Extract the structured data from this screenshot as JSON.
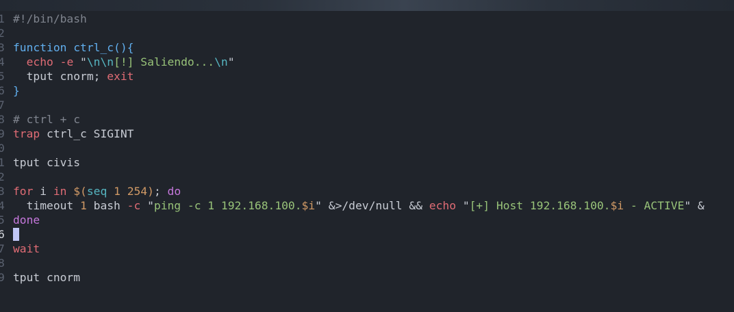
{
  "editor": {
    "lines": [
      {
        "n": "1",
        "tokens": [
          {
            "t": "#!/bin/bash",
            "c": "comment"
          }
        ]
      },
      {
        "n": "2",
        "tokens": []
      },
      {
        "n": "3",
        "tokens": [
          {
            "t": "function ctrl_c(){",
            "c": "kw"
          }
        ]
      },
      {
        "n": "4",
        "tokens": [
          {
            "t": "  ",
            "c": "plain"
          },
          {
            "t": "echo",
            "c": "red"
          },
          {
            "t": " ",
            "c": "plain"
          },
          {
            "t": "-e",
            "c": "red"
          },
          {
            "t": " \"",
            "c": "plain"
          },
          {
            "t": "\\n\\n",
            "c": "esc"
          },
          {
            "t": "[!] Saliendo...",
            "c": "str"
          },
          {
            "t": "\\n",
            "c": "esc"
          },
          {
            "t": "\"",
            "c": "plain"
          }
        ]
      },
      {
        "n": "5",
        "tokens": [
          {
            "t": "  tput cnorm; ",
            "c": "plain"
          },
          {
            "t": "exit",
            "c": "red"
          }
        ]
      },
      {
        "n": "6",
        "tokens": [
          {
            "t": "}",
            "c": "kw"
          }
        ]
      },
      {
        "n": "7",
        "tokens": []
      },
      {
        "n": "8",
        "tokens": [
          {
            "t": "# ctrl + c",
            "c": "comment"
          }
        ]
      },
      {
        "n": "9",
        "tokens": [
          {
            "t": "trap",
            "c": "red"
          },
          {
            "t": " ctrl_c SIGINT",
            "c": "plain"
          }
        ]
      },
      {
        "n": "0",
        "tokens": []
      },
      {
        "n": "1",
        "tokens": [
          {
            "t": "tput civis",
            "c": "plain"
          }
        ]
      },
      {
        "n": "2",
        "tokens": []
      },
      {
        "n": "3",
        "tokens": [
          {
            "t": "for",
            "c": "red"
          },
          {
            "t": " i ",
            "c": "plain"
          },
          {
            "t": "in",
            "c": "red"
          },
          {
            "t": " $(",
            "c": "num"
          },
          {
            "t": "seq",
            "c": "esc"
          },
          {
            "t": " 1 254",
            "c": "num"
          },
          {
            "t": ")",
            "c": "num"
          },
          {
            "t": "; ",
            "c": "plain"
          },
          {
            "t": "do",
            "c": "purple"
          }
        ]
      },
      {
        "n": "4",
        "tokens": [
          {
            "t": "  timeout ",
            "c": "plain"
          },
          {
            "t": "1",
            "c": "num"
          },
          {
            "t": " bash ",
            "c": "plain"
          },
          {
            "t": "-c",
            "c": "red"
          },
          {
            "t": " \"",
            "c": "plain"
          },
          {
            "t": "ping -c 1 192.168.100.",
            "c": "str"
          },
          {
            "t": "$i",
            "c": "num"
          },
          {
            "t": "\" &>/dev/null && ",
            "c": "plain"
          },
          {
            "t": "echo",
            "c": "red"
          },
          {
            "t": " \"",
            "c": "plain"
          },
          {
            "t": "[+] Host 192.168.100.",
            "c": "str"
          },
          {
            "t": "$i",
            "c": "num"
          },
          {
            "t": " - ACTIVE",
            "c": "str"
          },
          {
            "t": "\" &",
            "c": "plain"
          }
        ]
      },
      {
        "n": "5",
        "tokens": [
          {
            "t": "done",
            "c": "purple"
          }
        ]
      },
      {
        "n": "6",
        "tokens": [],
        "current": true,
        "cursor": true
      },
      {
        "n": "7",
        "tokens": [
          {
            "t": "wait",
            "c": "red"
          }
        ]
      },
      {
        "n": "8",
        "tokens": []
      },
      {
        "n": "9",
        "tokens": [
          {
            "t": "tput cnorm",
            "c": "plain"
          }
        ]
      }
    ]
  },
  "colors": {
    "background": "#20242b",
    "comment": "#7f848e",
    "keyword_blue": "#61afef",
    "keyword_red": "#e06c75",
    "string_green": "#98c379",
    "escape_cyan": "#56b6c2",
    "keyword_purple": "#c678dd",
    "number_orange": "#d19a66",
    "cursor": "#c0c6f5"
  }
}
